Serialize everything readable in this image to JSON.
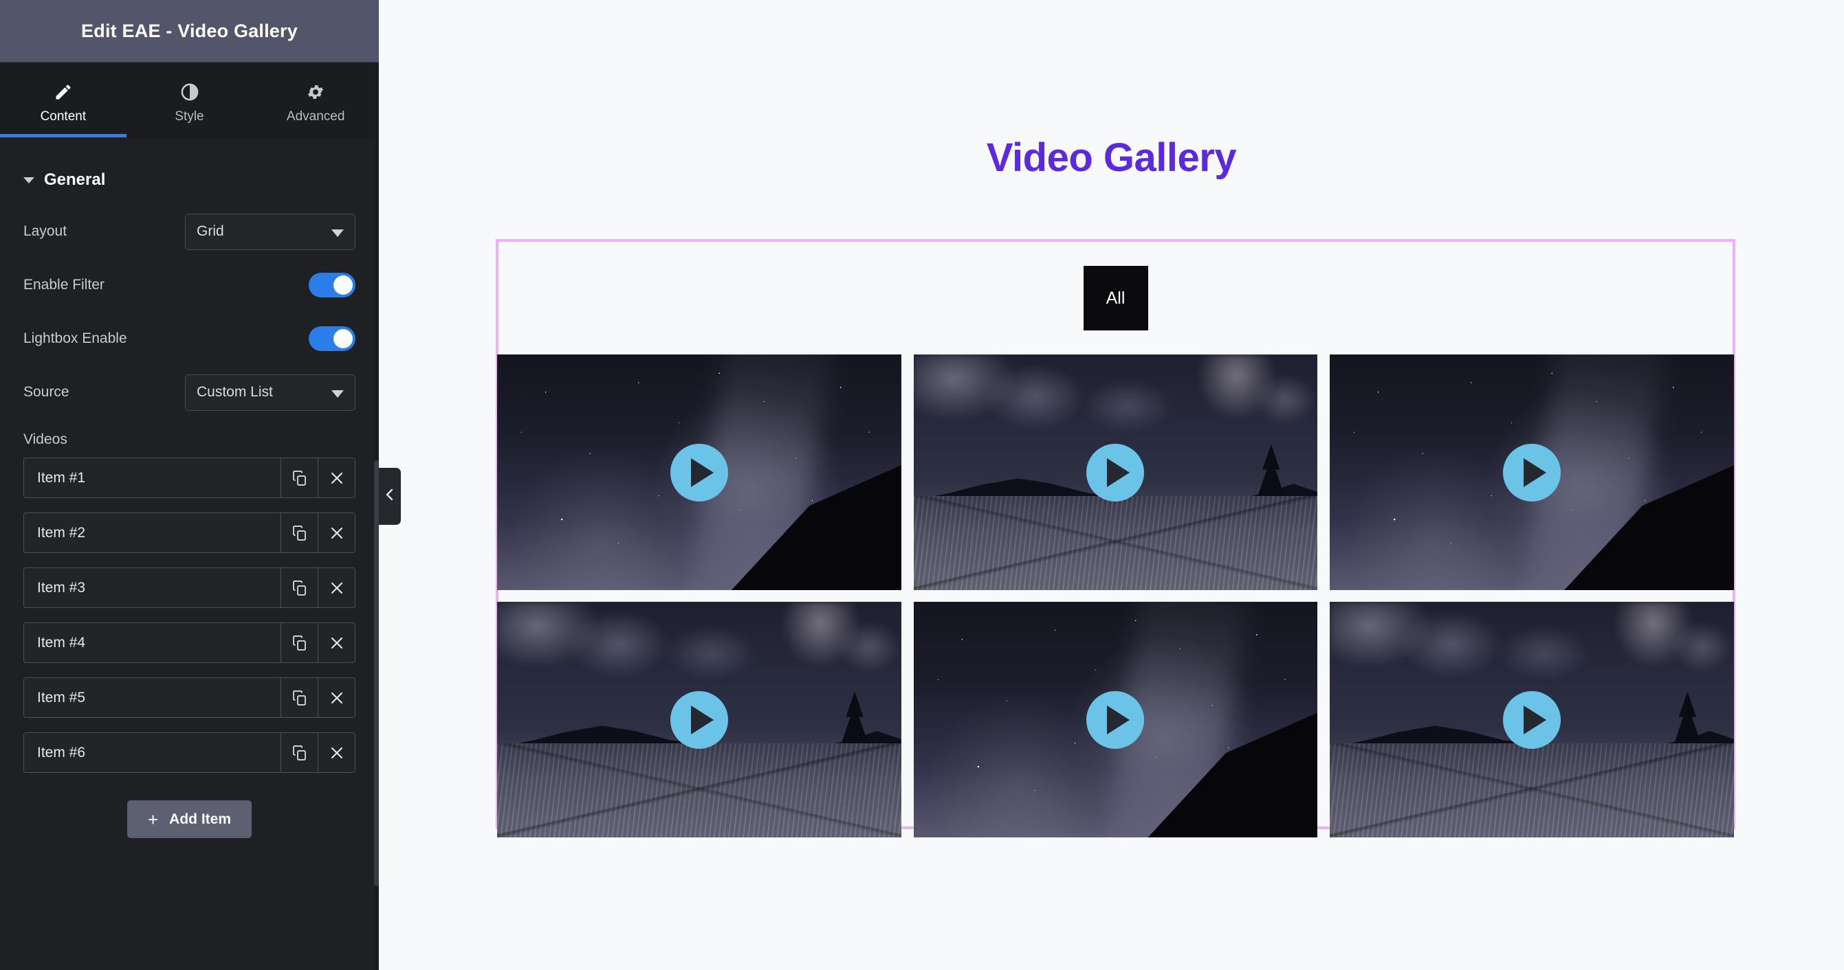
{
  "panel": {
    "title": "Edit EAE - Video Gallery",
    "tabs": [
      {
        "label": "Content",
        "icon": "pencil-icon",
        "active": true
      },
      {
        "label": "Style",
        "icon": "contrast-icon",
        "active": false
      },
      {
        "label": "Advanced",
        "icon": "gear-icon",
        "active": false
      }
    ],
    "section": {
      "title": "General",
      "expanded": true
    },
    "controls": [
      {
        "label": "Layout",
        "type": "select",
        "value": "Grid"
      },
      {
        "label": "Enable Filter",
        "type": "toggle",
        "value": "on"
      },
      {
        "label": "Lightbox Enable",
        "type": "toggle",
        "value": "on"
      },
      {
        "label": "Source",
        "type": "select",
        "value": "Custom List"
      }
    ],
    "repeater": {
      "label": "Videos",
      "items": [
        {
          "title": "Item #1"
        },
        {
          "title": "Item #2"
        },
        {
          "title": "Item #3"
        },
        {
          "title": "Item #4"
        },
        {
          "title": "Item #5"
        },
        {
          "title": "Item #6"
        }
      ],
      "duplicate_icon": "copy-icon",
      "remove_icon": "close-icon",
      "add_label": "Add Item",
      "add_icon": "plus-icon"
    },
    "collapse_icon": "chevron-left-icon"
  },
  "canvas": {
    "heading": "Video Gallery",
    "filters": [
      {
        "label": "All",
        "active": true
      }
    ],
    "videos": [
      {
        "index": 1,
        "thumb": "night-sky",
        "play_icon": "play-icon"
      },
      {
        "index": 2,
        "thumb": "snow-road",
        "play_icon": "play-icon"
      },
      {
        "index": 3,
        "thumb": "night-sky",
        "play_icon": "play-icon"
      },
      {
        "index": 4,
        "thumb": "snow-road",
        "play_icon": "play-icon"
      },
      {
        "index": 5,
        "thumb": "night-sky",
        "play_icon": "play-icon"
      },
      {
        "index": 6,
        "thumb": "snow-road",
        "play_icon": "play-icon"
      }
    ]
  },
  "colors": {
    "panel_titlebar": "#53566a",
    "panel_bg": "#1e2024",
    "tab_active_underline": "#3b7ce0",
    "toggle_on": "#2b7de8",
    "heading_purple": "#5b2ae0",
    "selection_pink": "#eeb0f5",
    "filter_active_bg": "#0b0b0d",
    "play_button": "#6bc4e8",
    "canvas_bg": "#f8f9fb"
  }
}
